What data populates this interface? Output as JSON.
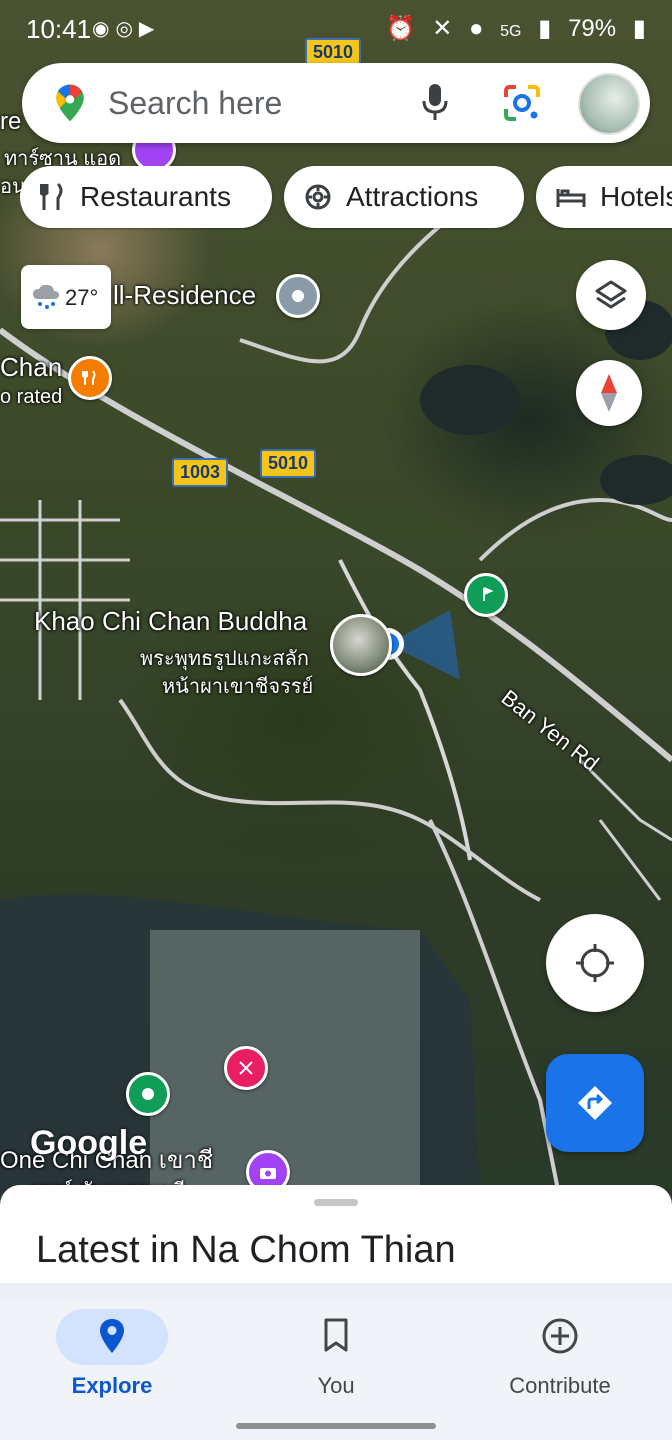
{
  "status_bar": {
    "time": "10:41",
    "signal": "5G",
    "battery": "79%"
  },
  "search": {
    "placeholder": "Search here"
  },
  "chips": [
    {
      "label": "Restaurants",
      "icon": "fork-knife-icon"
    },
    {
      "label": "Attractions",
      "icon": "attraction-icon"
    },
    {
      "label": "Hotels",
      "icon": "bed-icon"
    }
  ],
  "weather": {
    "temperature": "27°",
    "icon": "rain-cloud-icon"
  },
  "map": {
    "labels": {
      "residence": "ll-Residence",
      "chan": "Chan",
      "rated": "o rated",
      "top_thai": "ทาร์ซาน แอด",
      "top_left_a": "re",
      "top_left_b": "อน",
      "buddha_en": "Khao Chi Chan Buddha",
      "buddha_th_1": "พระพุทธรูปแกะสลัก",
      "buddha_th_2": "หน้าผาเขาชีจรรย์",
      "road": "Ban Yen Rd",
      "bottom_place": "One Chi Chan เขาชี",
      "bottom_place_2": "จรรย์ ขับเบลอแบรี"
    },
    "route_shields": [
      "5010",
      "1003",
      "5010"
    ],
    "google_logo": "Google",
    "colors": {
      "restaurant_poi": "#f57c00",
      "golf_poi": "#0f9d58",
      "park_poi": "#0f9d58",
      "activity_poi": "#e91e63",
      "photo_poi": "#a142f4",
      "location_dot": "#1a73e8"
    }
  },
  "sheet": {
    "title": "Latest in Na Chom Thian"
  },
  "nav": {
    "explore": "Explore",
    "you": "You",
    "contribute": "Contribute"
  }
}
